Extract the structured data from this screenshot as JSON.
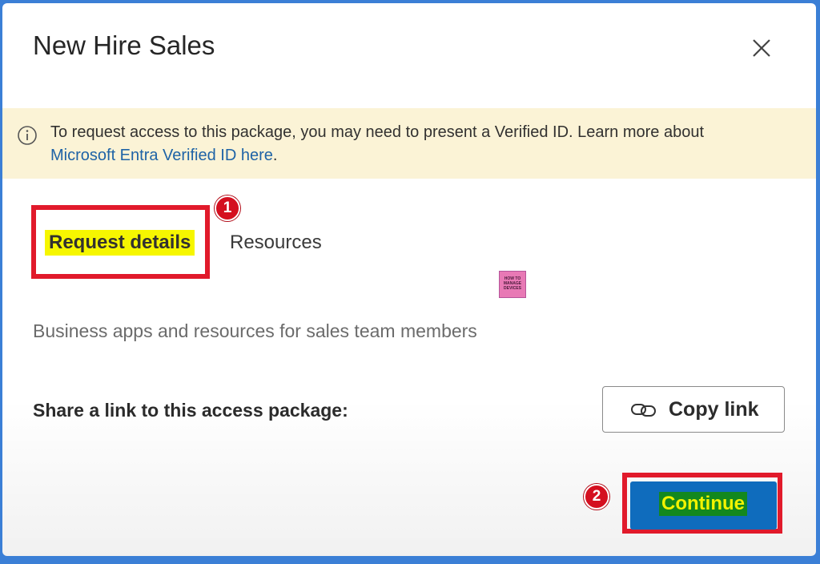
{
  "dialog": {
    "title": "New Hire Sales",
    "close_icon": "close-icon"
  },
  "banner": {
    "icon": "info-icon",
    "text": "To request access to this package, you may need to present a Verified ID. Learn more about ",
    "link_text": "Microsoft Entra Verified ID here",
    "end_text": "."
  },
  "tabs": [
    {
      "label": "Request details",
      "selected": true
    },
    {
      "label": "Resources",
      "selected": false
    }
  ],
  "annotations": [
    {
      "number": "1",
      "target": "tab-request-details"
    },
    {
      "number": "2",
      "target": "continue-button"
    }
  ],
  "watermark": {
    "text": "HOW TO MANAGE DEVICES"
  },
  "description": "Business apps and resources for sales team members",
  "share": {
    "label": "Share a link to this access package:",
    "copy_label": "Copy link",
    "copy_icon": "link-icon"
  },
  "footer": {
    "continue_label": "Continue"
  },
  "colors": {
    "accent": "#0f6cbd",
    "banner_bg": "#fbf3d6",
    "annotation_red": "#e11a2b",
    "highlight_yellow": "#f6f600"
  }
}
